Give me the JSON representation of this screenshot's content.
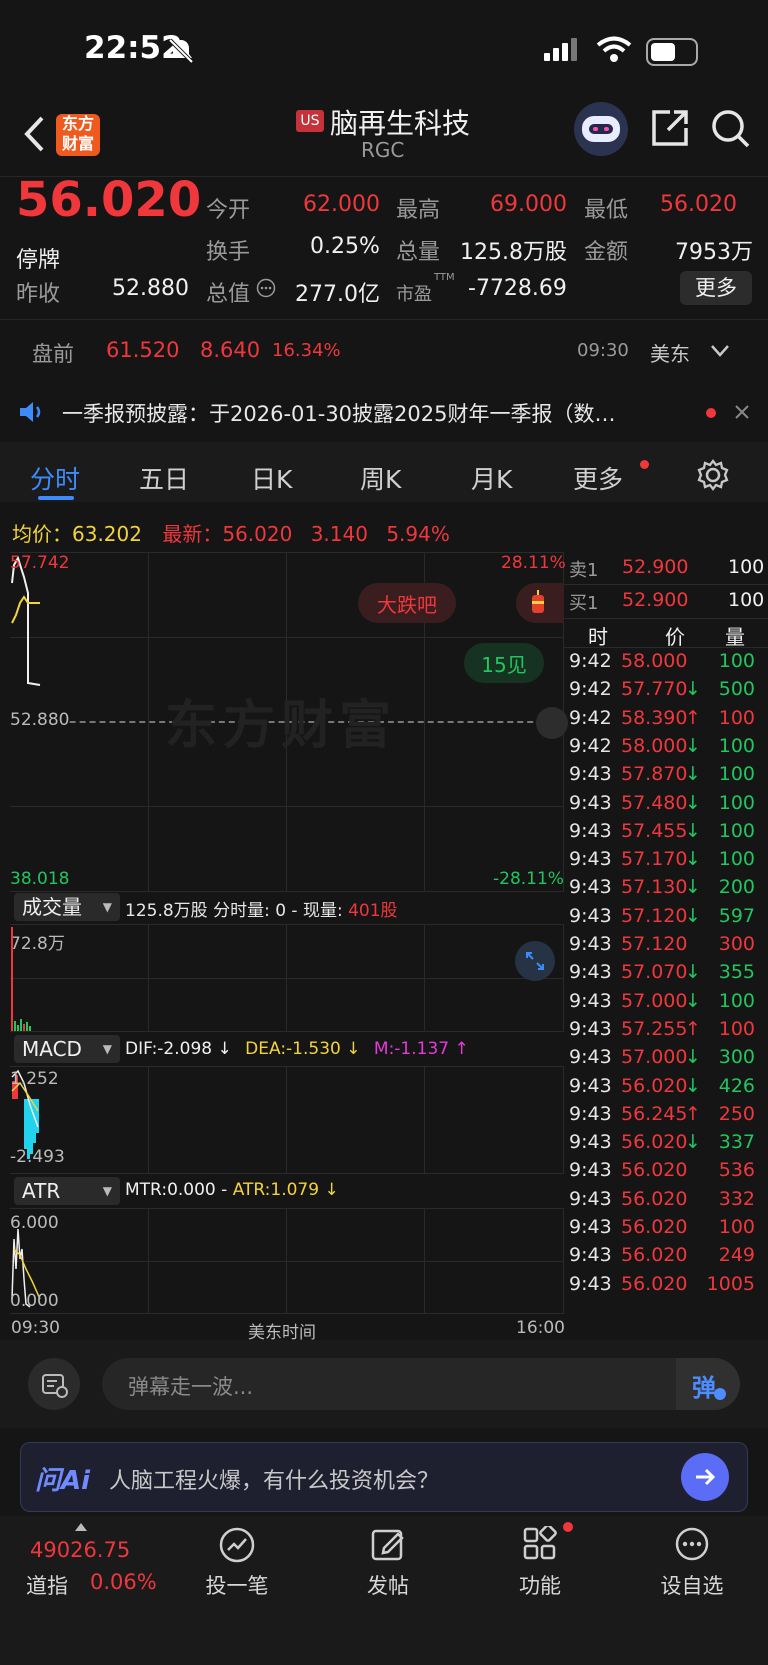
{
  "status_bar": {
    "time": "22:52"
  },
  "header": {
    "brand_logo_text": "东方财富",
    "market_badge": "US",
    "stock_name": "脑再生科技",
    "ticker": "RGC"
  },
  "quote": {
    "price": "56.020",
    "status": "停牌",
    "prev_close_label": "昨收",
    "prev_close": "52.880",
    "open_label": "今开",
    "open": "62.000",
    "high_label": "最高",
    "high": "69.000",
    "low_label": "最低",
    "low": "56.020",
    "turnover_label": "换手",
    "turnover": "0.25%",
    "volume_label": "总量",
    "volume": "125.8万股",
    "amount_label": "金额",
    "amount": "7953万",
    "market_cap_label": "总值",
    "market_cap": "277.0亿",
    "pe_label": "市盈",
    "pe_sup": "TTM",
    "pe": "-7728.69",
    "more_button": "更多"
  },
  "premarket": {
    "label": "盘前",
    "price": "61.520",
    "change": "8.640",
    "change_pct": "16.34%",
    "time": "09:30",
    "timezone": "美东"
  },
  "notice": {
    "text": "一季报预披露：于2026-01-30披露2025财年一季报（数…"
  },
  "tabs": [
    {
      "label": "分时",
      "active": true
    },
    {
      "label": "五日"
    },
    {
      "label": "日K"
    },
    {
      "label": "周K"
    },
    {
      "label": "月K"
    },
    {
      "label": "更多"
    }
  ],
  "chart_info": {
    "avg_label": "均价：",
    "avg_value": "63.202",
    "latest_label": "最新：",
    "latest_value": "56.020",
    "latest_change": "3.140",
    "latest_pct": "5.94%"
  },
  "chart_data": {
    "type": "line",
    "price_axis": {
      "top": "57.742",
      "mid": "52.880",
      "bottom": "38.018"
    },
    "pct_axis": {
      "top": "28.11%",
      "bottom": "-28.11%"
    },
    "x_start": "09:30",
    "x_mid": "美东时间",
    "x_end": "16:00",
    "watermark": "东方财富",
    "bubble_down": "大跌吧",
    "bubble_up": "15见",
    "volume_panel": {
      "label": "成交量",
      "summary": "125.8万股 分时量: 0 - 现量:",
      "current": "401股",
      "axis_top": "72.8万"
    },
    "macd_panel": {
      "label": "MACD",
      "dif": "DIF:-2.098 ↓",
      "dea": "DEA:-1.530 ↓",
      "m": "M:-1.137 ↑",
      "axis_top": "1.252",
      "axis_bottom": "-2.493"
    },
    "atr_panel": {
      "label": "ATR",
      "mtr": "MTR:0.000 -",
      "atr": "ATR:1.079 ↓",
      "axis_top": "6.000",
      "axis_bottom": "0.000"
    }
  },
  "order_book": {
    "sell1_label": "卖1",
    "sell1_price": "52.900",
    "sell1_qty": "100",
    "buy1_label": "买1",
    "buy1_price": "52.900",
    "buy1_qty": "100",
    "col_time": "时",
    "col_price": "价",
    "col_qty": "量"
  },
  "trades": [
    {
      "time": "9:42",
      "price": "58.000",
      "arrow": "",
      "qty": "100",
      "qty_color": "green"
    },
    {
      "time": "9:42",
      "price": "57.770",
      "arrow": "↓",
      "qty": "500",
      "qty_color": "green"
    },
    {
      "time": "9:42",
      "price": "58.390",
      "arrow": "↑",
      "qty": "100",
      "qty_color": "red"
    },
    {
      "time": "9:42",
      "price": "58.000",
      "arrow": "↓",
      "qty": "100",
      "qty_color": "green"
    },
    {
      "time": "9:43",
      "price": "57.870",
      "arrow": "↓",
      "qty": "100",
      "qty_color": "green"
    },
    {
      "time": "9:43",
      "price": "57.480",
      "arrow": "↓",
      "qty": "100",
      "qty_color": "green"
    },
    {
      "time": "9:43",
      "price": "57.455",
      "arrow": "↓",
      "qty": "100",
      "qty_color": "green"
    },
    {
      "time": "9:43",
      "price": "57.170",
      "arrow": "↓",
      "qty": "100",
      "qty_color": "green"
    },
    {
      "time": "9:43",
      "price": "57.130",
      "arrow": "↓",
      "qty": "200",
      "qty_color": "green"
    },
    {
      "time": "9:43",
      "price": "57.120",
      "arrow": "↓",
      "qty": "597",
      "qty_color": "green"
    },
    {
      "time": "9:43",
      "price": "57.120",
      "arrow": "",
      "qty": "300",
      "qty_color": "red"
    },
    {
      "time": "9:43",
      "price": "57.070",
      "arrow": "↓",
      "qty": "355",
      "qty_color": "green"
    },
    {
      "time": "9:43",
      "price": "57.000",
      "arrow": "↓",
      "qty": "100",
      "qty_color": "green"
    },
    {
      "time": "9:43",
      "price": "57.255",
      "arrow": "↑",
      "qty": "100",
      "qty_color": "red"
    },
    {
      "time": "9:43",
      "price": "57.000",
      "arrow": "↓",
      "qty": "300",
      "qty_color": "green"
    },
    {
      "time": "9:43",
      "price": "56.020",
      "arrow": "↓",
      "qty": "426",
      "qty_color": "green"
    },
    {
      "time": "9:43",
      "price": "56.245",
      "arrow": "↑",
      "qty": "250",
      "qty_color": "red"
    },
    {
      "time": "9:43",
      "price": "56.020",
      "arrow": "↓",
      "qty": "337",
      "qty_color": "green"
    },
    {
      "time": "9:43",
      "price": "56.020",
      "arrow": "",
      "qty": "536",
      "qty_color": "red"
    },
    {
      "time": "9:43",
      "price": "56.020",
      "arrow": "",
      "qty": "332",
      "qty_color": "red"
    },
    {
      "time": "9:43",
      "price": "56.020",
      "arrow": "",
      "qty": "100",
      "qty_color": "red"
    },
    {
      "time": "9:43",
      "price": "56.020",
      "arrow": "",
      "qty": "249",
      "qty_color": "red"
    },
    {
      "time": "9:43",
      "price": "56.020",
      "arrow": "",
      "qty": "1005",
      "qty_color": "red"
    }
  ],
  "danmaku": {
    "placeholder": "弹幕走一波...",
    "button": "弹"
  },
  "ai_bar": {
    "logo": "问Ai",
    "prompt": "人脑工程火爆，有什么投资机会？"
  },
  "bottom_nav": {
    "index_value": "49026.75",
    "index_name": "道指",
    "index_pct": "0.06%",
    "items": [
      {
        "label": "投一笔",
        "icon": "trend-icon"
      },
      {
        "label": "发帖",
        "icon": "edit-icon"
      },
      {
        "label": "功能",
        "icon": "grid-icon"
      },
      {
        "label": "设自选",
        "icon": "more-icon"
      }
    ]
  },
  "colors": {
    "up": "#f0373c",
    "down": "#22c55e",
    "accent": "#3d8bfd",
    "background": "#151515"
  }
}
